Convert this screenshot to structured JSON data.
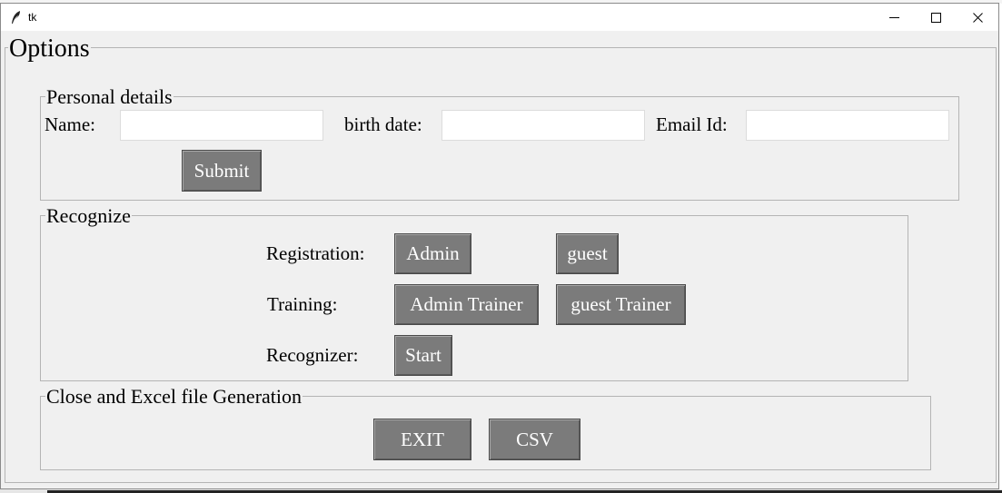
{
  "window": {
    "title": "tk",
    "minimize_glyph": "—",
    "maximize_glyph": "☐",
    "close_glyph": "✕"
  },
  "options": {
    "title": "Options"
  },
  "personal": {
    "title": "Personal details",
    "name_label": "Name:",
    "name_value": "",
    "birth_label": "birth date:",
    "birth_value": "",
    "email_label": "Email Id:",
    "email_value": "",
    "submit_label": "Submit"
  },
  "recognize": {
    "title": "Recognize",
    "registration_label": "Registration:",
    "admin_label": "Admin",
    "guest_label": "guest",
    "training_label": "Training:",
    "admin_trainer_label": "Admin Trainer",
    "guest_trainer_label": "guest Trainer",
    "recognizer_label": "Recognizer:",
    "start_label": "Start"
  },
  "close_section": {
    "title": "Close and Excel file Generation",
    "exit_label": "EXIT",
    "csv_label": "CSV"
  },
  "colors": {
    "button_bg": "#7b7b7b",
    "button_text": "#ffffff",
    "window_bg": "#f0f0f0",
    "frame_border": "#b4b4b4"
  }
}
